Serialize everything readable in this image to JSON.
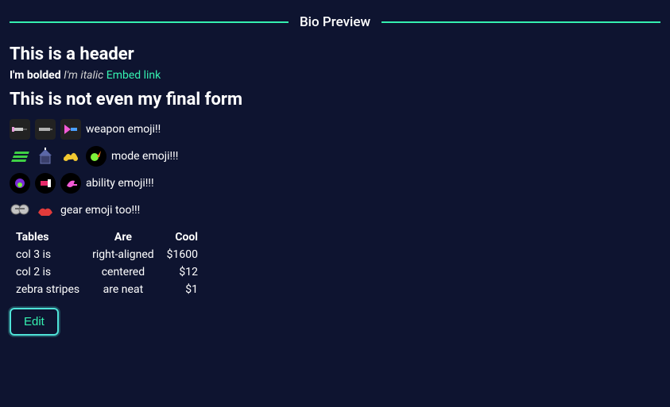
{
  "panel_title": "Bio Preview",
  "header1": "This is a header",
  "inline": {
    "bold": "I'm bolded",
    "italic": "I'm italic",
    "link": "Embed link"
  },
  "header2": "This is not even my final form",
  "emoji_lines": {
    "weapons": "weapon emoji!!",
    "modes": "mode emoji!!!",
    "abilities": "ability emoji!!!",
    "gear": "gear emoji too!!!"
  },
  "table": {
    "headers": [
      "Tables",
      "Are",
      "Cool"
    ],
    "rows": [
      [
        "col 3 is",
        "right-aligned",
        "$1600"
      ],
      [
        "col 2 is",
        "centered",
        "$12"
      ],
      [
        "zebra stripes",
        "are neat",
        "$1"
      ]
    ]
  },
  "edit_label": "Edit"
}
